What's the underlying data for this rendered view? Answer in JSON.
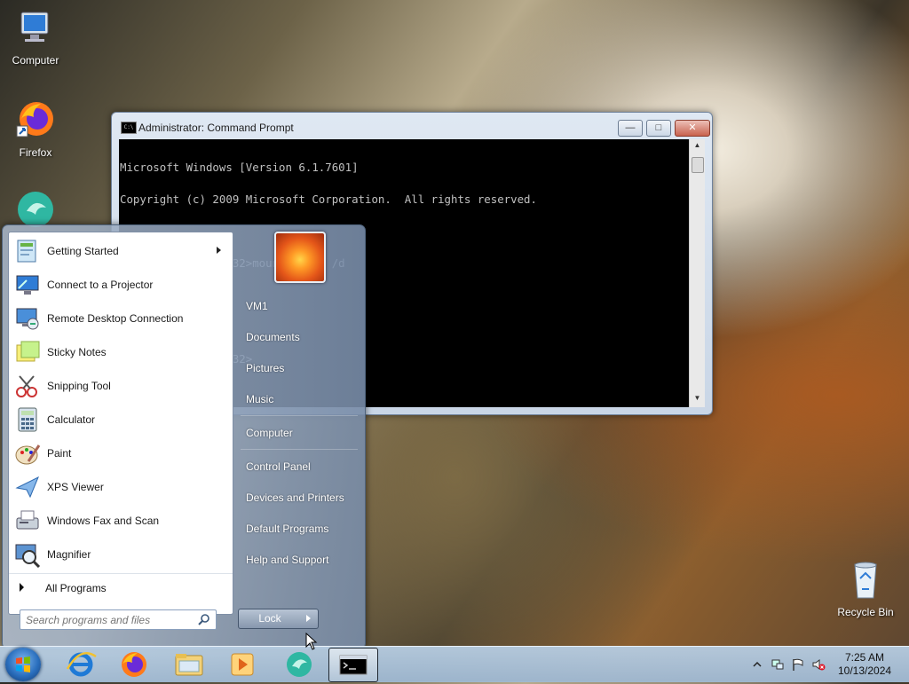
{
  "desktop": {
    "icons": [
      {
        "label": "Computer",
        "icon": "computer-icon"
      },
      {
        "label": "Firefox",
        "icon": "firefox-icon"
      },
      {
        "label": "Recycle Bin",
        "icon": "recycle-bin-icon"
      }
    ]
  },
  "cmd": {
    "title": "Administrator: Command Prompt",
    "lines": [
      "Microsoft Windows [Version 6.1.7601]",
      "Copyright (c) 2009 Microsoft Corporation.  All rights reserved.",
      "",
      "C:\\Windows\\system32>mountvol c: /d",
      "",
      "",
      "C:\\Windows\\system32>"
    ]
  },
  "start_menu": {
    "programs": [
      {
        "label": "Getting Started",
        "icon": "getting-started-icon",
        "has_submenu": true
      },
      {
        "label": "Connect to a Projector",
        "icon": "projector-icon"
      },
      {
        "label": "Remote Desktop Connection",
        "icon": "remote-desktop-icon"
      },
      {
        "label": "Sticky Notes",
        "icon": "sticky-notes-icon"
      },
      {
        "label": "Snipping Tool",
        "icon": "snipping-tool-icon"
      },
      {
        "label": "Calculator",
        "icon": "calculator-icon"
      },
      {
        "label": "Paint",
        "icon": "paint-icon"
      },
      {
        "label": "XPS Viewer",
        "icon": "xps-viewer-icon"
      },
      {
        "label": "Windows Fax and Scan",
        "icon": "fax-scan-icon"
      },
      {
        "label": "Magnifier",
        "icon": "magnifier-icon"
      }
    ],
    "all_programs": "All Programs",
    "search_placeholder": "Search programs and files",
    "right_items": [
      "VM1",
      "Documents",
      "Pictures",
      "Music",
      "Computer",
      "Control Panel",
      "Devices and Printers",
      "Default Programs",
      "Help and Support"
    ],
    "lock_label": "Lock"
  },
  "taskbar": {
    "pinned": [
      "internet-explorer-icon",
      "firefox-icon",
      "explorer-icon",
      "media-player-icon",
      "app-icon",
      "command-prompt-icon"
    ],
    "clock_time": "7:25 AM",
    "clock_date": "10/13/2024"
  }
}
